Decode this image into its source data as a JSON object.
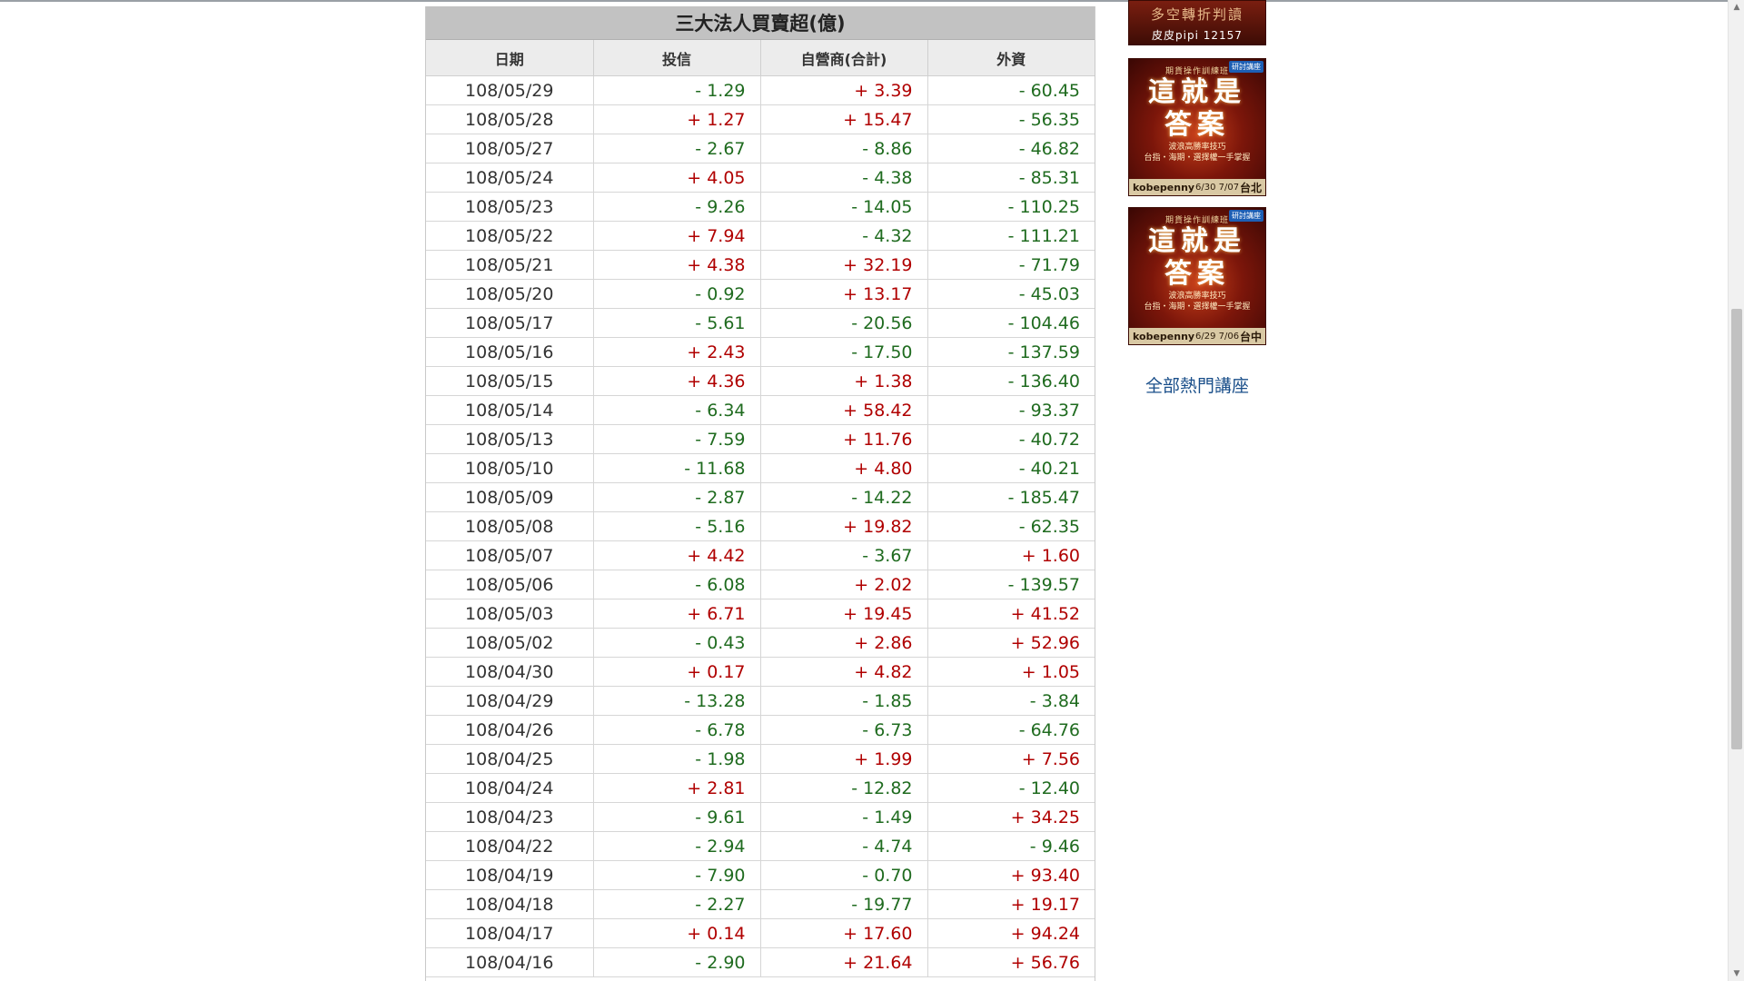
{
  "table": {
    "title": "三大法人買賣超(億)",
    "headers": [
      "日期",
      "投信",
      "自營商(合計)",
      "外資"
    ],
    "rows": [
      [
        "108/05/29",
        "- 1.29",
        "+ 3.39",
        "- 60.45"
      ],
      [
        "108/05/28",
        "+ 1.27",
        "+ 15.47",
        "- 56.35"
      ],
      [
        "108/05/27",
        "- 2.67",
        "- 8.86",
        "- 46.82"
      ],
      [
        "108/05/24",
        "+ 4.05",
        "- 4.38",
        "- 85.31"
      ],
      [
        "108/05/23",
        "- 9.26",
        "- 14.05",
        "- 110.25"
      ],
      [
        "108/05/22",
        "+ 7.94",
        "- 4.32",
        "- 111.21"
      ],
      [
        "108/05/21",
        "+ 4.38",
        "+ 32.19",
        "- 71.79"
      ],
      [
        "108/05/20",
        "- 0.92",
        "+ 13.17",
        "- 45.03"
      ],
      [
        "108/05/17",
        "- 5.61",
        "- 20.56",
        "- 104.46"
      ],
      [
        "108/05/16",
        "+ 2.43",
        "- 17.50",
        "- 137.59"
      ],
      [
        "108/05/15",
        "+ 4.36",
        "+ 1.38",
        "- 136.40"
      ],
      [
        "108/05/14",
        "- 6.34",
        "+ 58.42",
        "- 93.37"
      ],
      [
        "108/05/13",
        "- 7.59",
        "+ 11.76",
        "- 40.72"
      ],
      [
        "108/05/10",
        "- 11.68",
        "+ 4.80",
        "- 40.21"
      ],
      [
        "108/05/09",
        "- 2.87",
        "- 14.22",
        "- 185.47"
      ],
      [
        "108/05/08",
        "- 5.16",
        "+ 19.82",
        "- 62.35"
      ],
      [
        "108/05/07",
        "+ 4.42",
        "- 3.67",
        "+ 1.60"
      ],
      [
        "108/05/06",
        "- 6.08",
        "+ 2.02",
        "- 139.57"
      ],
      [
        "108/05/03",
        "+ 6.71",
        "+ 19.45",
        "+ 41.52"
      ],
      [
        "108/05/02",
        "- 0.43",
        "+ 2.86",
        "+ 52.96"
      ],
      [
        "108/04/30",
        "+ 0.17",
        "+ 4.82",
        "+ 1.05"
      ],
      [
        "108/04/29",
        "- 13.28",
        "- 1.85",
        "- 3.84"
      ],
      [
        "108/04/26",
        "- 6.78",
        "- 6.73",
        "- 64.76"
      ],
      [
        "108/04/25",
        "- 1.98",
        "+ 1.99",
        "+ 7.56"
      ],
      [
        "108/04/24",
        "+ 2.81",
        "- 12.82",
        "- 12.40"
      ],
      [
        "108/04/23",
        "- 9.61",
        "- 1.49",
        "+ 34.25"
      ],
      [
        "108/04/22",
        "- 2.94",
        "- 4.74",
        "- 9.46"
      ],
      [
        "108/04/19",
        "- 7.90",
        "- 0.70",
        "+ 93.40"
      ],
      [
        "108/04/18",
        "- 2.27",
        "- 19.77",
        "+ 19.17"
      ],
      [
        "108/04/17",
        "+ 0.14",
        "+ 17.60",
        "+ 94.24"
      ],
      [
        "108/04/16",
        "- 2.90",
        "+ 21.64",
        "+ 56.76"
      ]
    ]
  },
  "sidebar": {
    "ad1": {
      "line1": "多空轉折判讀",
      "line2": "皮皮pipi 12157"
    },
    "ad2": {
      "badge": "研討講座",
      "sub": "期貨操作訓練班",
      "head1": "這就是",
      "head2": "答案",
      "desc1": "波浪高勝率技巧",
      "desc2": "台指・海期・選擇權一手掌握",
      "brand": "kobepenny",
      "dates": "6/30 7/07",
      "city": "台北"
    },
    "ad3": {
      "badge": "研討講座",
      "sub": "期貨操作訓練班",
      "head1": "這就是",
      "head2": "答案",
      "desc1": "波浪高勝率技巧",
      "desc2": "台指・海期・選擇權一手掌握",
      "brand": "kobepenny",
      "dates": "6/29 7/06",
      "city": "台中"
    },
    "hot_link": "全部熱門講座"
  },
  "colors": {
    "positive": "#b00000",
    "negative": "#1f6b1f",
    "title_bg": "#c2c2c2",
    "link": "#1a4f8a"
  }
}
